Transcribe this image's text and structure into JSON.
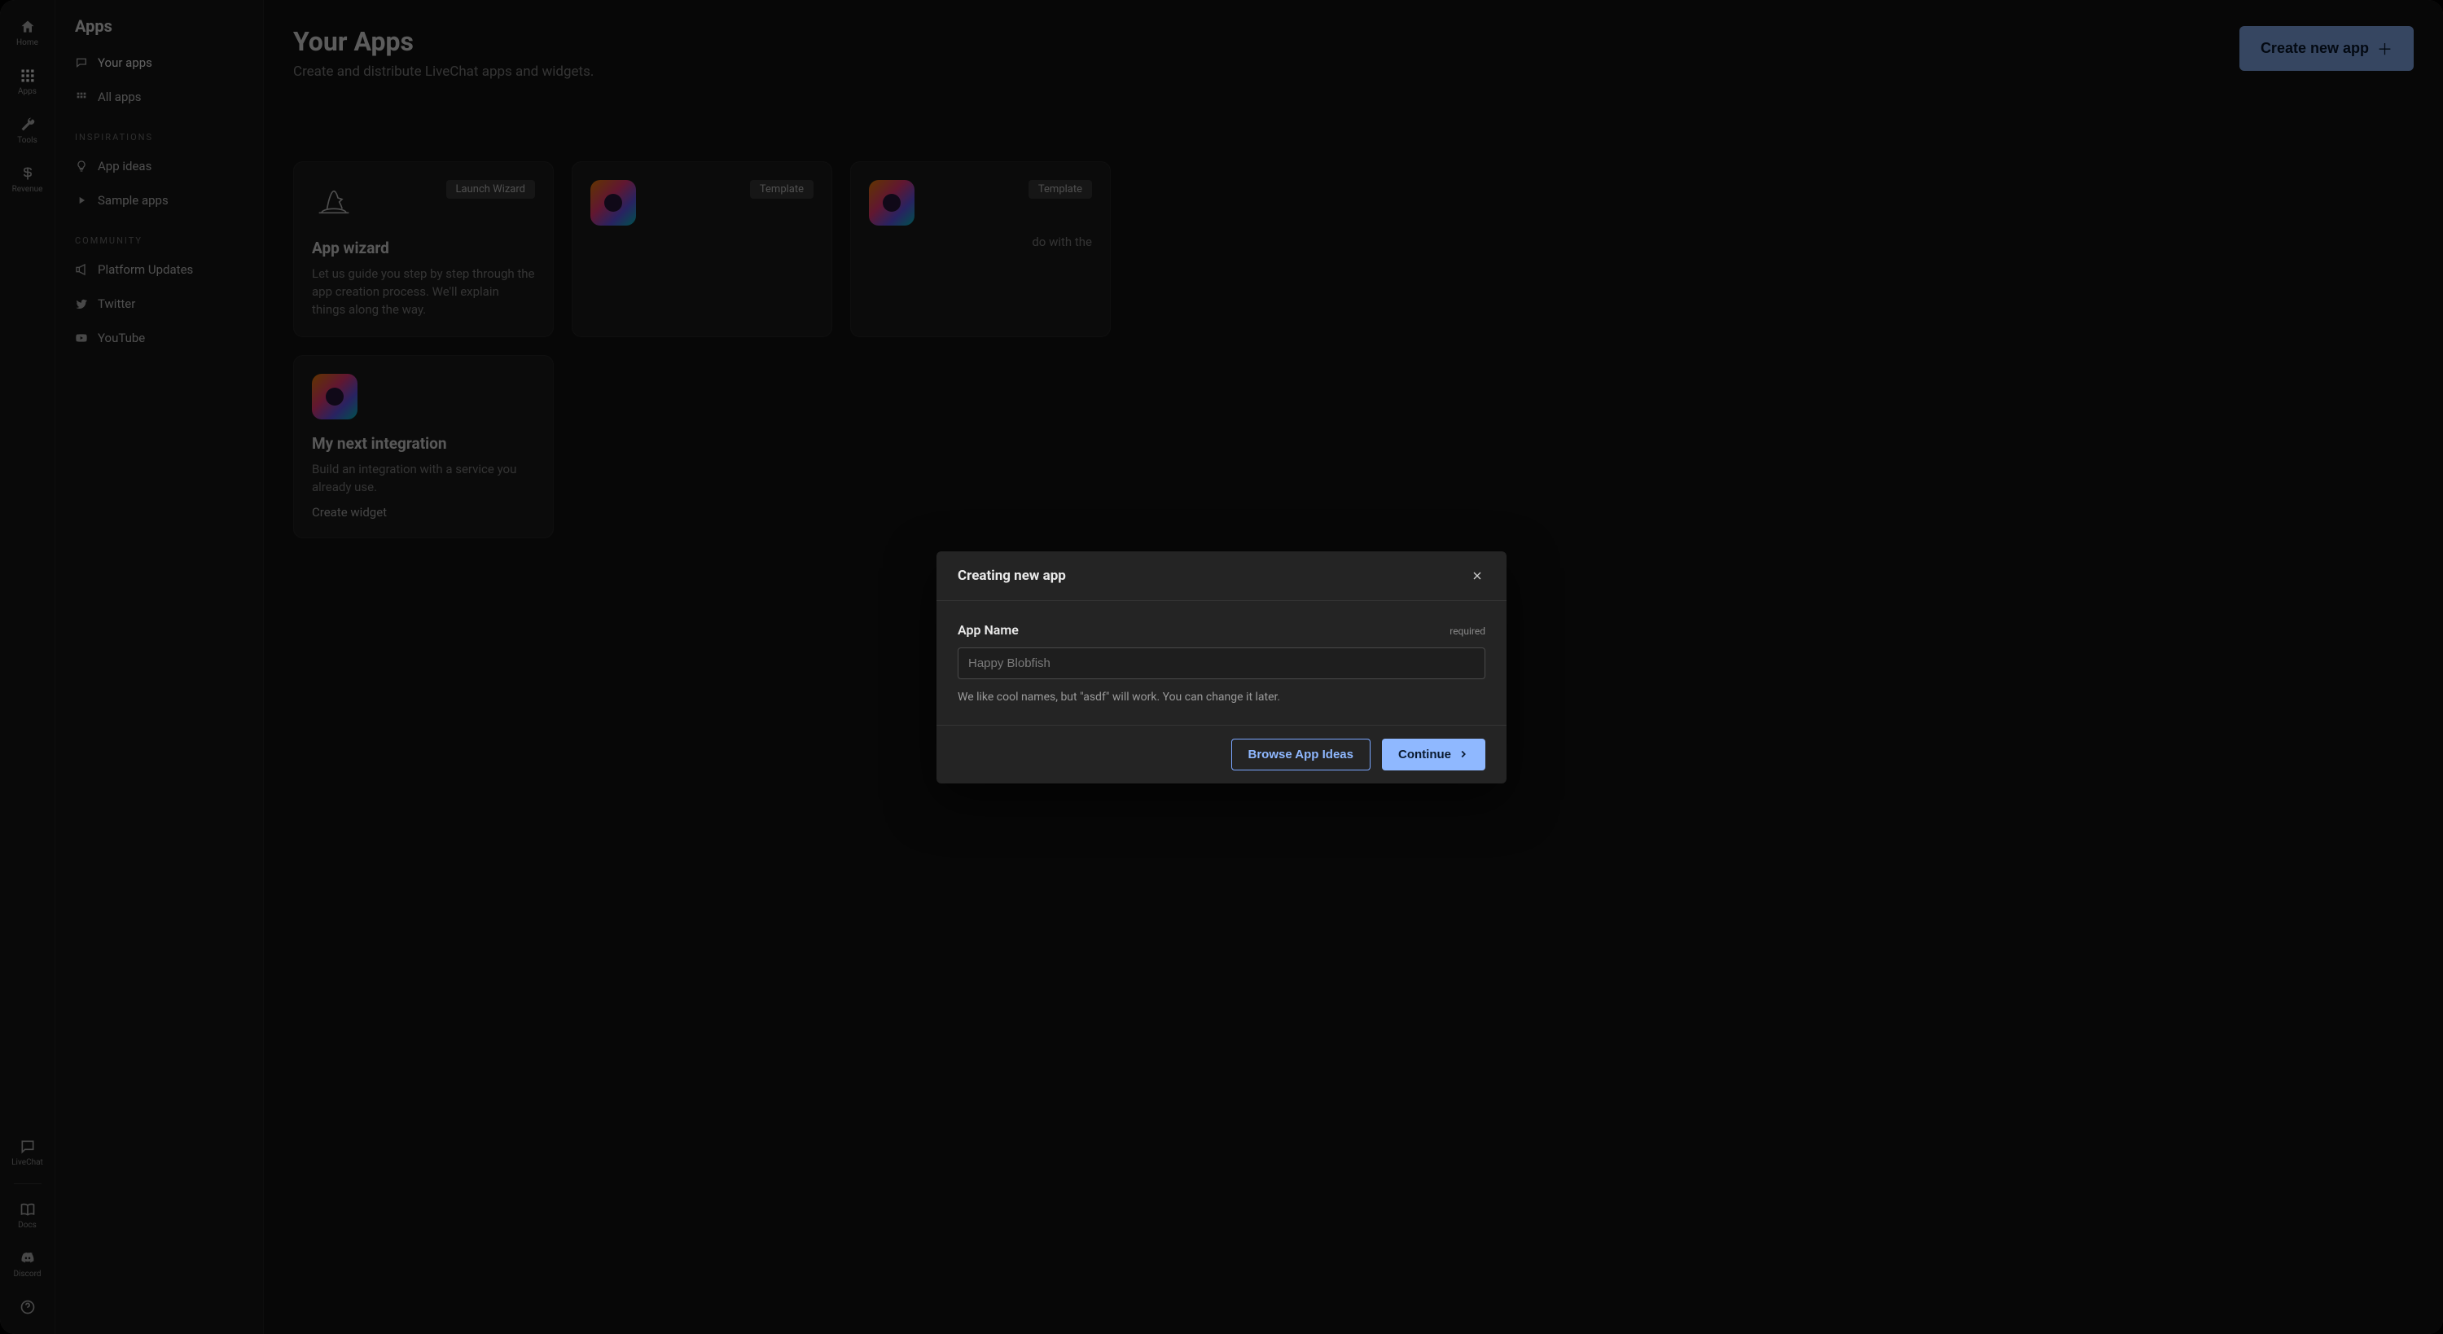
{
  "rail": {
    "home": "Home",
    "apps": "Apps",
    "tools": "Tools",
    "revenue": "Revenue",
    "livechat": "LiveChat",
    "docs": "Docs",
    "discord": "Discord"
  },
  "subnav": {
    "title": "Apps",
    "your_apps": "Your apps",
    "all_apps": "All apps",
    "section_inspirations": "Inspirations",
    "app_ideas": "App ideas",
    "sample_apps": "Sample apps",
    "section_community": "Community",
    "platform_updates": "Platform Updates",
    "twitter": "Twitter",
    "youtube": "YouTube"
  },
  "main": {
    "title": "Your Apps",
    "subtitle": "Create and distribute LiveChat apps and widgets.",
    "create_btn": "Create new app"
  },
  "cards": {
    "wizard": {
      "tag": "Launch Wizard",
      "title": "App wizard",
      "desc": "Let us guide you step by step through the app creation process. We'll explain things along the way."
    },
    "template_a": {
      "tag": "Template"
    },
    "template_b": {
      "tag": "Template",
      "desc_tail": "do with the"
    },
    "integration": {
      "title": "My next integration",
      "desc": "Build an integration with a service you already use.",
      "link": "Create widget"
    }
  },
  "modal": {
    "title": "Creating new app",
    "field_label": "App Name",
    "required": "required",
    "placeholder": "Happy Blobfish",
    "helper": "We like cool names, but \"asdf\" will work. You can change it later.",
    "browse": "Browse App Ideas",
    "continue": "Continue"
  }
}
